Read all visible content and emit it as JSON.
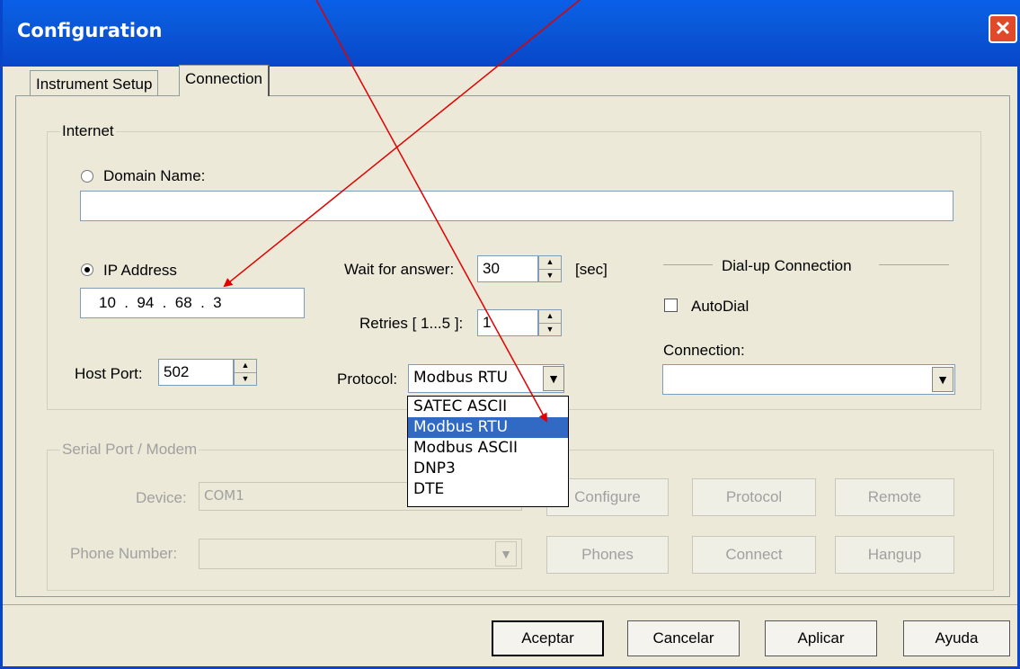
{
  "window": {
    "title": "Configuration"
  },
  "tabs": [
    {
      "label": "Instrument Setup",
      "active": false
    },
    {
      "label": "Connection",
      "active": true
    }
  ],
  "internet": {
    "legend": "Internet",
    "domain_label": "Domain Name:",
    "domain_value": "",
    "ip_label": "IP Address",
    "ip_octets": [
      "10",
      "94",
      "68",
      "3"
    ],
    "ip_separator": ".",
    "host_port_label": "Host Port:",
    "host_port_value": "502",
    "wait_label": "Wait for answer:",
    "wait_value": "30",
    "wait_unit": "[sec]",
    "retries_label": "Retries [ 1...5 ]:",
    "retries_value": "1",
    "protocol_label": "Protocol:",
    "protocol_value": "Modbus RTU",
    "protocol_options": [
      "SATEC ASCII",
      "Modbus RTU",
      "Modbus ASCII",
      "DNP3",
      "DTE"
    ],
    "protocol_selected_index": 1
  },
  "dialup": {
    "heading": "Dial-up Connection",
    "autodial_label": "AutoDial",
    "connection_label": "Connection:",
    "connection_value": ""
  },
  "serial": {
    "legend": "Serial Port / Modem",
    "device_label": "Device:",
    "device_value": "COM1",
    "phone_label": "Phone Number:",
    "phone_value": "",
    "buttons": {
      "configure": "Configure",
      "protocol": "Protocol",
      "remote": "Remote",
      "phones": "Phones",
      "connect": "Connect",
      "hangup": "Hangup"
    }
  },
  "footer": {
    "accept": "Aceptar",
    "cancel": "Cancelar",
    "apply": "Aplicar",
    "help": "Ayuda"
  },
  "annotation_color": "#e00000"
}
